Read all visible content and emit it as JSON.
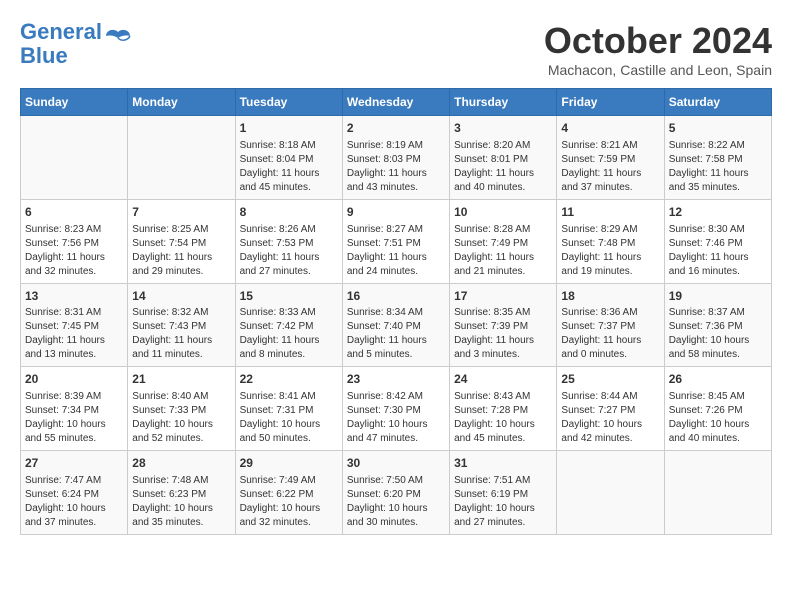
{
  "header": {
    "logo_line1": "General",
    "logo_line2": "Blue",
    "month": "October 2024",
    "location": "Machacon, Castille and Leon, Spain"
  },
  "weekdays": [
    "Sunday",
    "Monday",
    "Tuesday",
    "Wednesday",
    "Thursday",
    "Friday",
    "Saturday"
  ],
  "weeks": [
    [
      {
        "day": "",
        "content": ""
      },
      {
        "day": "",
        "content": ""
      },
      {
        "day": "1",
        "content": "Sunrise: 8:18 AM\nSunset: 8:04 PM\nDaylight: 11 hours and 45 minutes."
      },
      {
        "day": "2",
        "content": "Sunrise: 8:19 AM\nSunset: 8:03 PM\nDaylight: 11 hours and 43 minutes."
      },
      {
        "day": "3",
        "content": "Sunrise: 8:20 AM\nSunset: 8:01 PM\nDaylight: 11 hours and 40 minutes."
      },
      {
        "day": "4",
        "content": "Sunrise: 8:21 AM\nSunset: 7:59 PM\nDaylight: 11 hours and 37 minutes."
      },
      {
        "day": "5",
        "content": "Sunrise: 8:22 AM\nSunset: 7:58 PM\nDaylight: 11 hours and 35 minutes."
      }
    ],
    [
      {
        "day": "6",
        "content": "Sunrise: 8:23 AM\nSunset: 7:56 PM\nDaylight: 11 hours and 32 minutes."
      },
      {
        "day": "7",
        "content": "Sunrise: 8:25 AM\nSunset: 7:54 PM\nDaylight: 11 hours and 29 minutes."
      },
      {
        "day": "8",
        "content": "Sunrise: 8:26 AM\nSunset: 7:53 PM\nDaylight: 11 hours and 27 minutes."
      },
      {
        "day": "9",
        "content": "Sunrise: 8:27 AM\nSunset: 7:51 PM\nDaylight: 11 hours and 24 minutes."
      },
      {
        "day": "10",
        "content": "Sunrise: 8:28 AM\nSunset: 7:49 PM\nDaylight: 11 hours and 21 minutes."
      },
      {
        "day": "11",
        "content": "Sunrise: 8:29 AM\nSunset: 7:48 PM\nDaylight: 11 hours and 19 minutes."
      },
      {
        "day": "12",
        "content": "Sunrise: 8:30 AM\nSunset: 7:46 PM\nDaylight: 11 hours and 16 minutes."
      }
    ],
    [
      {
        "day": "13",
        "content": "Sunrise: 8:31 AM\nSunset: 7:45 PM\nDaylight: 11 hours and 13 minutes."
      },
      {
        "day": "14",
        "content": "Sunrise: 8:32 AM\nSunset: 7:43 PM\nDaylight: 11 hours and 11 minutes."
      },
      {
        "day": "15",
        "content": "Sunrise: 8:33 AM\nSunset: 7:42 PM\nDaylight: 11 hours and 8 minutes."
      },
      {
        "day": "16",
        "content": "Sunrise: 8:34 AM\nSunset: 7:40 PM\nDaylight: 11 hours and 5 minutes."
      },
      {
        "day": "17",
        "content": "Sunrise: 8:35 AM\nSunset: 7:39 PM\nDaylight: 11 hours and 3 minutes."
      },
      {
        "day": "18",
        "content": "Sunrise: 8:36 AM\nSunset: 7:37 PM\nDaylight: 11 hours and 0 minutes."
      },
      {
        "day": "19",
        "content": "Sunrise: 8:37 AM\nSunset: 7:36 PM\nDaylight: 10 hours and 58 minutes."
      }
    ],
    [
      {
        "day": "20",
        "content": "Sunrise: 8:39 AM\nSunset: 7:34 PM\nDaylight: 10 hours and 55 minutes."
      },
      {
        "day": "21",
        "content": "Sunrise: 8:40 AM\nSunset: 7:33 PM\nDaylight: 10 hours and 52 minutes."
      },
      {
        "day": "22",
        "content": "Sunrise: 8:41 AM\nSunset: 7:31 PM\nDaylight: 10 hours and 50 minutes."
      },
      {
        "day": "23",
        "content": "Sunrise: 8:42 AM\nSunset: 7:30 PM\nDaylight: 10 hours and 47 minutes."
      },
      {
        "day": "24",
        "content": "Sunrise: 8:43 AM\nSunset: 7:28 PM\nDaylight: 10 hours and 45 minutes."
      },
      {
        "day": "25",
        "content": "Sunrise: 8:44 AM\nSunset: 7:27 PM\nDaylight: 10 hours and 42 minutes."
      },
      {
        "day": "26",
        "content": "Sunrise: 8:45 AM\nSunset: 7:26 PM\nDaylight: 10 hours and 40 minutes."
      }
    ],
    [
      {
        "day": "27",
        "content": "Sunrise: 7:47 AM\nSunset: 6:24 PM\nDaylight: 10 hours and 37 minutes."
      },
      {
        "day": "28",
        "content": "Sunrise: 7:48 AM\nSunset: 6:23 PM\nDaylight: 10 hours and 35 minutes."
      },
      {
        "day": "29",
        "content": "Sunrise: 7:49 AM\nSunset: 6:22 PM\nDaylight: 10 hours and 32 minutes."
      },
      {
        "day": "30",
        "content": "Sunrise: 7:50 AM\nSunset: 6:20 PM\nDaylight: 10 hours and 30 minutes."
      },
      {
        "day": "31",
        "content": "Sunrise: 7:51 AM\nSunset: 6:19 PM\nDaylight: 10 hours and 27 minutes."
      },
      {
        "day": "",
        "content": ""
      },
      {
        "day": "",
        "content": ""
      }
    ]
  ]
}
